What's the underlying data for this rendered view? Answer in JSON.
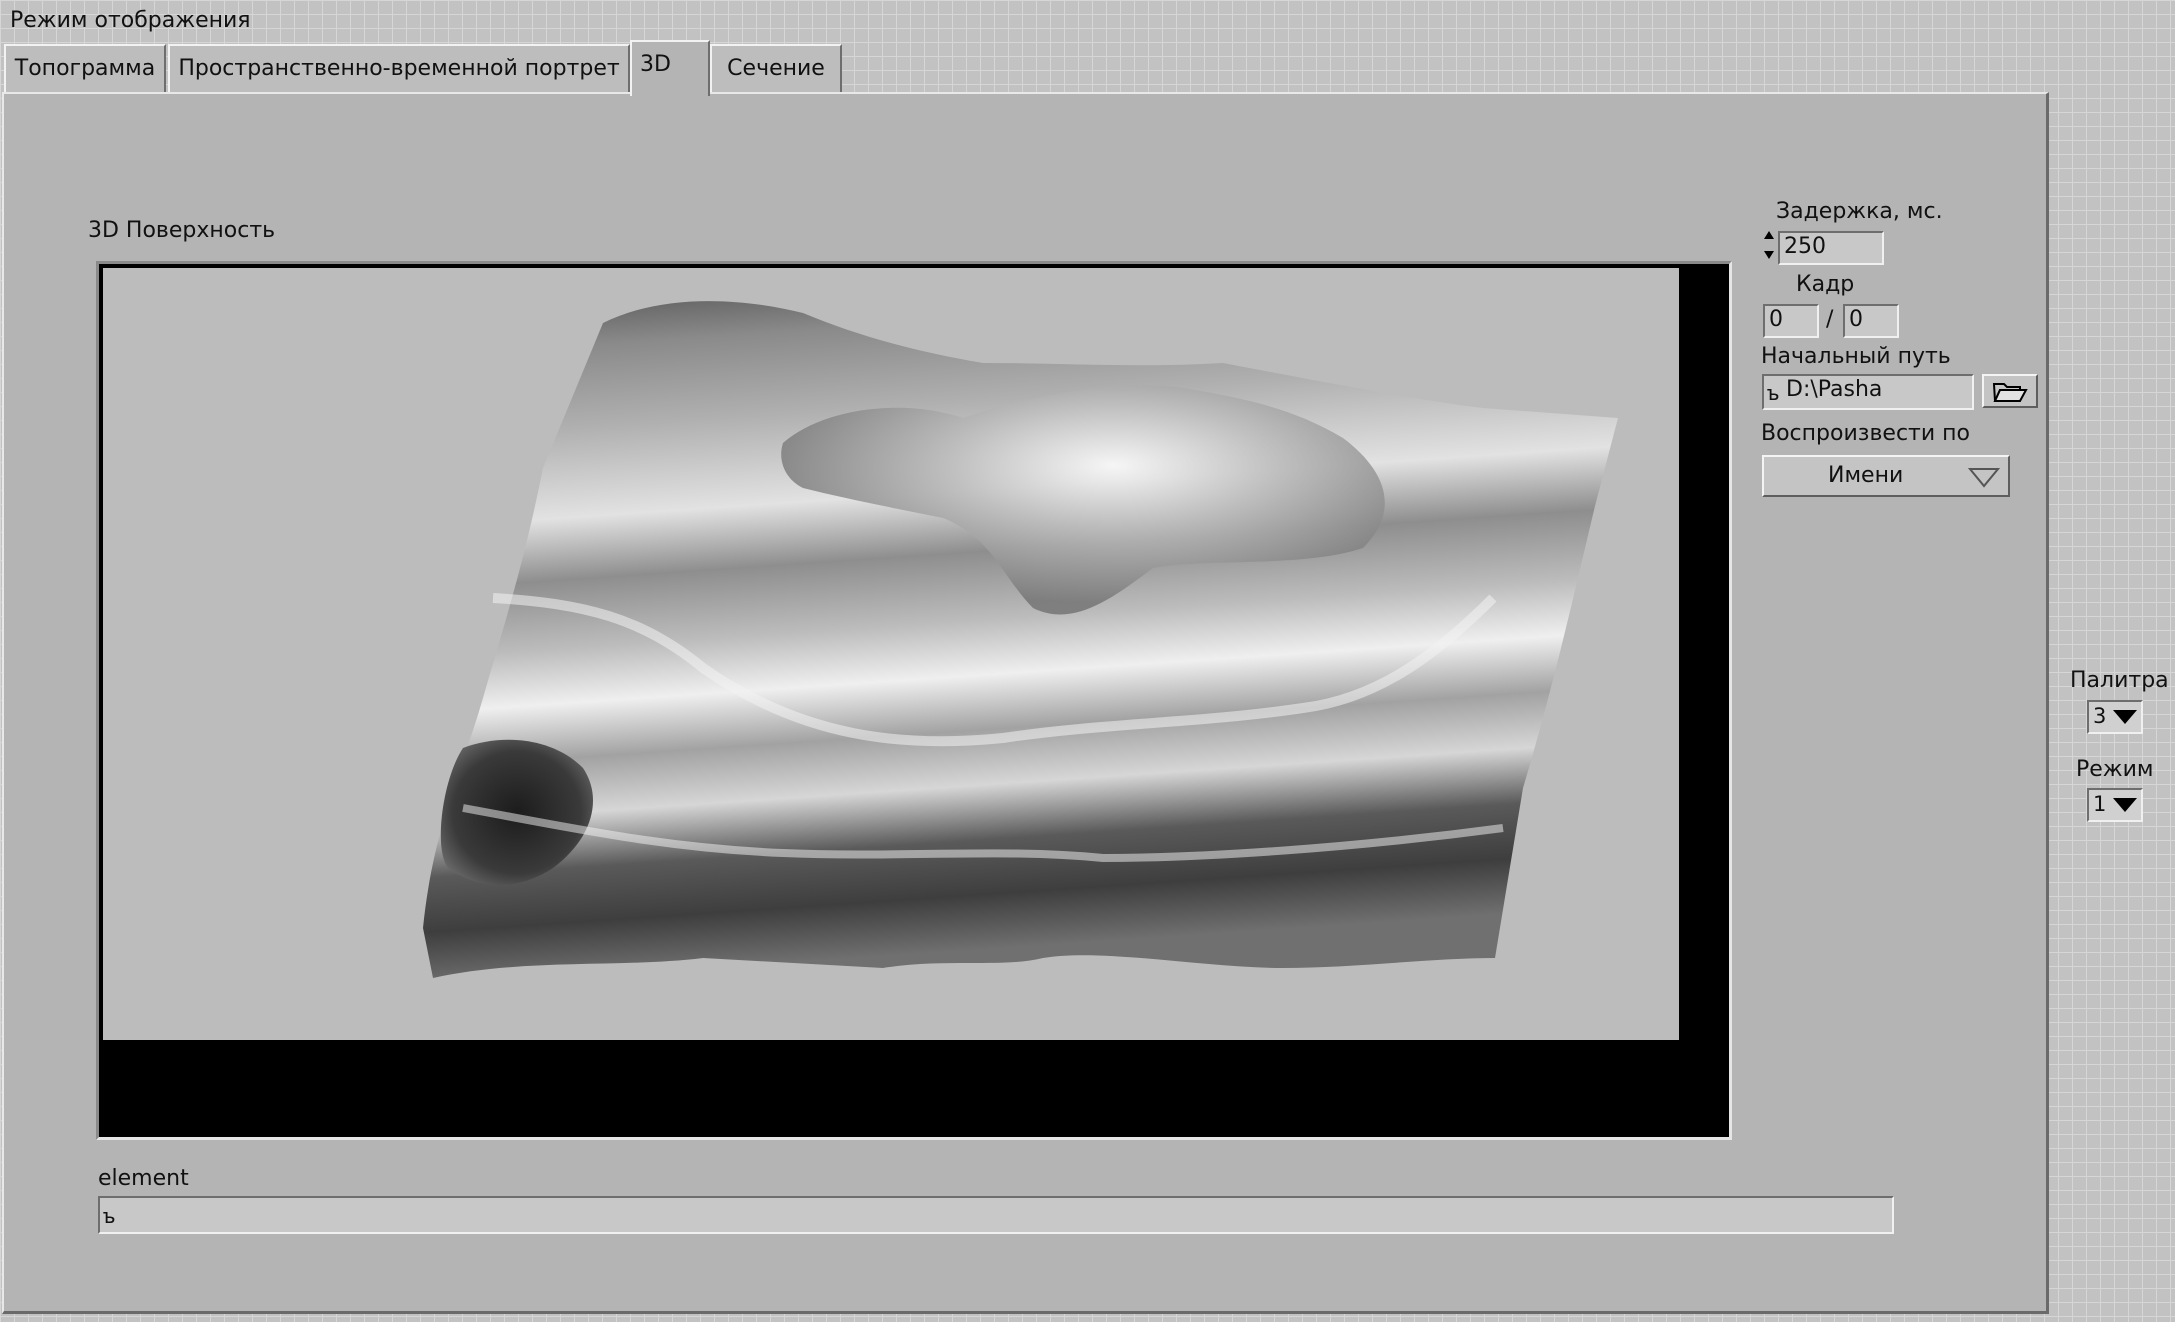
{
  "window": {
    "title": "Режим отображения"
  },
  "tabs": [
    {
      "label": "Топограмма"
    },
    {
      "label": "Пространственно-временной портрет"
    },
    {
      "label": "3D",
      "active": true
    },
    {
      "label": "Сечение"
    }
  ],
  "plot": {
    "label": "3D Поверхность"
  },
  "controls": {
    "delay": {
      "label": "Задержка, мс.",
      "value": "250"
    },
    "frame": {
      "label": "Кадр",
      "current": "0",
      "separator": "/",
      "total": "0"
    },
    "start_path": {
      "label": "Начальный путь",
      "value": "D:\\Pasha"
    },
    "play_by": {
      "label": "Воспроизвести по",
      "value": "Имени"
    },
    "palette": {
      "label": "Палитра",
      "value": "3"
    },
    "mode": {
      "label": "Режим",
      "value": "1"
    }
  },
  "element": {
    "label": "element",
    "value": ""
  },
  "icons": {
    "path_symbol": "path-icon",
    "browse": "folder-open-icon",
    "increment": "up-arrow-icon",
    "decrement": "down-arrow-icon",
    "dropdown": "chevron-down-icon"
  }
}
